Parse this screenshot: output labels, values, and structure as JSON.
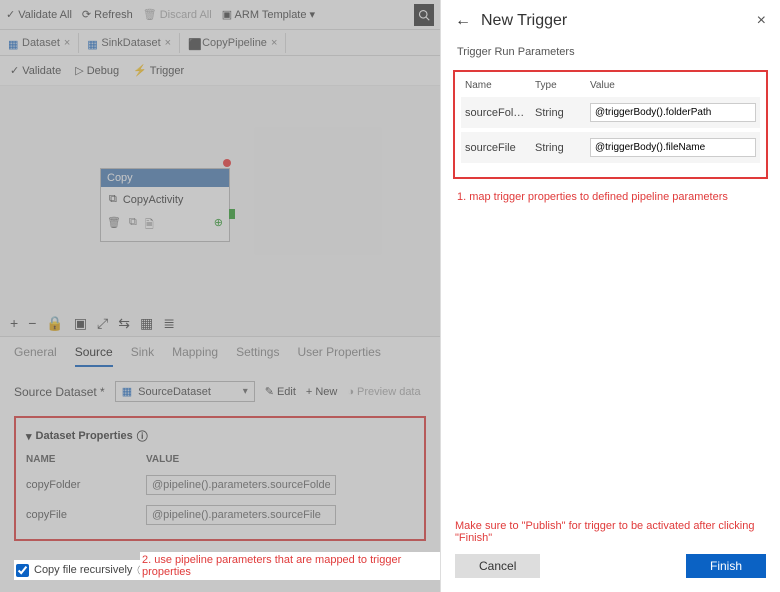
{
  "topbar": {
    "validate_all": "Validate All",
    "refresh": "Refresh",
    "discard_all": "Discard All",
    "arm_template": "ARM Template"
  },
  "tabs": [
    {
      "label": "Dataset"
    },
    {
      "label": "SinkDataset"
    },
    {
      "label": "CopyPipeline"
    }
  ],
  "actions": {
    "validate": "Validate",
    "debug": "Debug",
    "trigger": "Trigger"
  },
  "activity": {
    "head": "Copy",
    "name": "CopyActivity"
  },
  "lower_tabs": {
    "general": "General",
    "source": "Source",
    "sink": "Sink",
    "mapping": "Mapping",
    "settings": "Settings",
    "user_props": "User Properties"
  },
  "source": {
    "label": "Source Dataset *",
    "selected": "SourceDataset",
    "edit": "Edit",
    "new": "New",
    "preview": "Preview data"
  },
  "dataset_props": {
    "title": "Dataset Properties",
    "name_hdr": "NAME",
    "value_hdr": "VALUE",
    "rows": [
      {
        "name": "copyFolder",
        "value": "@pipeline().parameters.sourceFolder"
      },
      {
        "name": "copyFile",
        "value": "@pipeline().parameters.sourceFile"
      }
    ]
  },
  "copy_recursive": "Copy file recursively",
  "annotation2": "2. use pipeline parameters that are mapped to trigger properties",
  "panel": {
    "title": "New Trigger",
    "subtitle": "Trigger Run Parameters",
    "hdr_name": "Name",
    "hdr_type": "Type",
    "hdr_value": "Value",
    "params": [
      {
        "name": "sourceFol…",
        "type": "String",
        "value": "@triggerBody().folderPath"
      },
      {
        "name": "sourceFile",
        "type": "String",
        "value": "@triggerBody().fileName"
      }
    ],
    "annotation1": "1. map trigger properties to defined pipeline parameters",
    "warn": "Make sure to \"Publish\" for trigger to be activated after clicking \"Finish\"",
    "cancel": "Cancel",
    "finish": "Finish"
  }
}
